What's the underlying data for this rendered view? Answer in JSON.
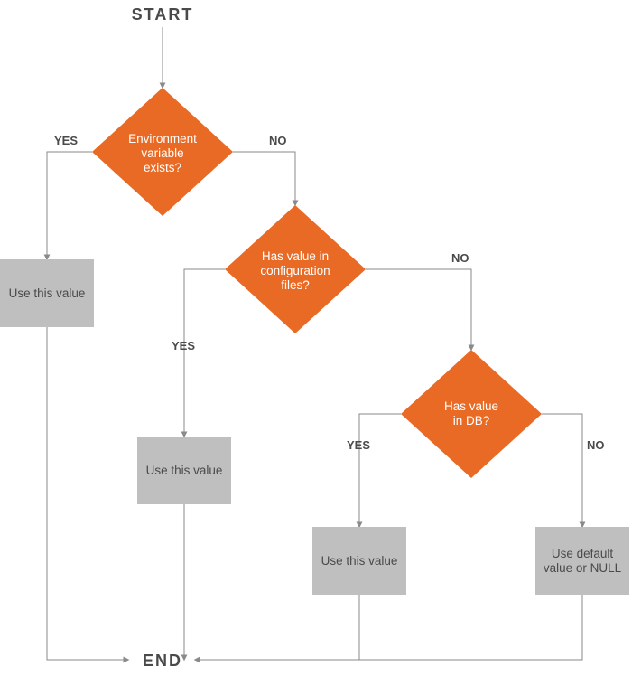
{
  "chart_data": {
    "type": "flowchart",
    "title": "",
    "nodes": [
      {
        "id": "start",
        "kind": "terminator",
        "label": "START"
      },
      {
        "id": "d1",
        "kind": "decision",
        "label": "Environment variable exists?"
      },
      {
        "id": "p1",
        "kind": "process",
        "label": "Use this value"
      },
      {
        "id": "d2",
        "kind": "decision",
        "label": "Has value in configuration files?"
      },
      {
        "id": "p2",
        "kind": "process",
        "label": "Use this value"
      },
      {
        "id": "d3",
        "kind": "decision",
        "label": "Has value in DB?"
      },
      {
        "id": "p3",
        "kind": "process",
        "label": "Use this value"
      },
      {
        "id": "p4",
        "kind": "process",
        "label": "Use default value or NULL"
      },
      {
        "id": "end",
        "kind": "terminator",
        "label": "END"
      }
    ],
    "edges": [
      {
        "from": "start",
        "to": "d1",
        "label": ""
      },
      {
        "from": "d1",
        "to": "p1",
        "label": "YES"
      },
      {
        "from": "d1",
        "to": "d2",
        "label": "NO"
      },
      {
        "from": "d2",
        "to": "p2",
        "label": "YES"
      },
      {
        "from": "d2",
        "to": "d3",
        "label": "NO"
      },
      {
        "from": "d3",
        "to": "p3",
        "label": "YES"
      },
      {
        "from": "d3",
        "to": "p4",
        "label": "NO"
      },
      {
        "from": "p1",
        "to": "end",
        "label": ""
      },
      {
        "from": "p2",
        "to": "end",
        "label": ""
      },
      {
        "from": "p3",
        "to": "end",
        "label": ""
      },
      {
        "from": "p4",
        "to": "end",
        "label": ""
      }
    ],
    "labels": {
      "start": "START",
      "end": "END",
      "yes": "YES",
      "no": "NO",
      "d1_l1": "Environment",
      "d1_l2": "variable",
      "d1_l3": "exists?",
      "d2_l1": "Has value in",
      "d2_l2": "configuration",
      "d2_l3": "files?",
      "d3_l1": "Has value",
      "d3_l2": "in DB?",
      "p_use": "Use this value",
      "p4_l1": "Use default",
      "p4_l2": "value or NULL"
    }
  }
}
